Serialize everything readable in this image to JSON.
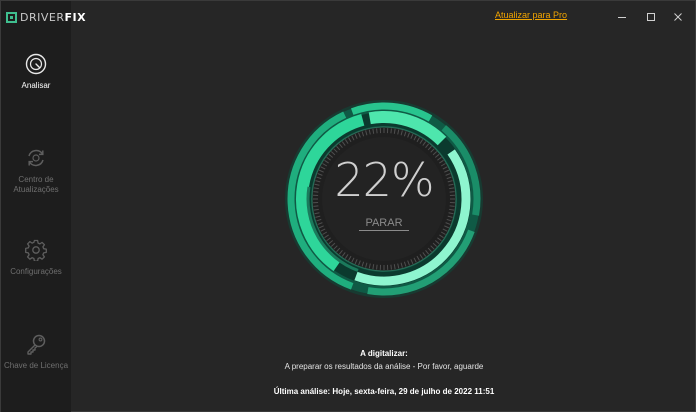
{
  "app": {
    "logo_prefix": "DRIVER",
    "logo_suffix": "FIX",
    "accent": "#3fbf8f",
    "upgrade_color": "#f1a400"
  },
  "titlebar": {
    "upgrade_label": "Atualizar para Pro"
  },
  "sidebar": {
    "items": [
      {
        "label": "Analisar",
        "icon": "gauge-icon",
        "active": true
      },
      {
        "label": "Centro de Atualizações",
        "icon": "refresh-icon",
        "active": false
      },
      {
        "label": "Configurações",
        "icon": "gear-icon",
        "active": false
      },
      {
        "label": "Chave de Licença",
        "icon": "key-icon",
        "active": false
      }
    ]
  },
  "scan": {
    "progress_label": "22%",
    "progress": 0.22,
    "stop_label": "PARAR",
    "status_title": "A digitalizar:",
    "status_message": "A preparar os resultados da análise - Por favor, aguarde",
    "last_scan": "Última análise: Hoje, sexta-feira, 29 de julho de 2022 11:51"
  }
}
